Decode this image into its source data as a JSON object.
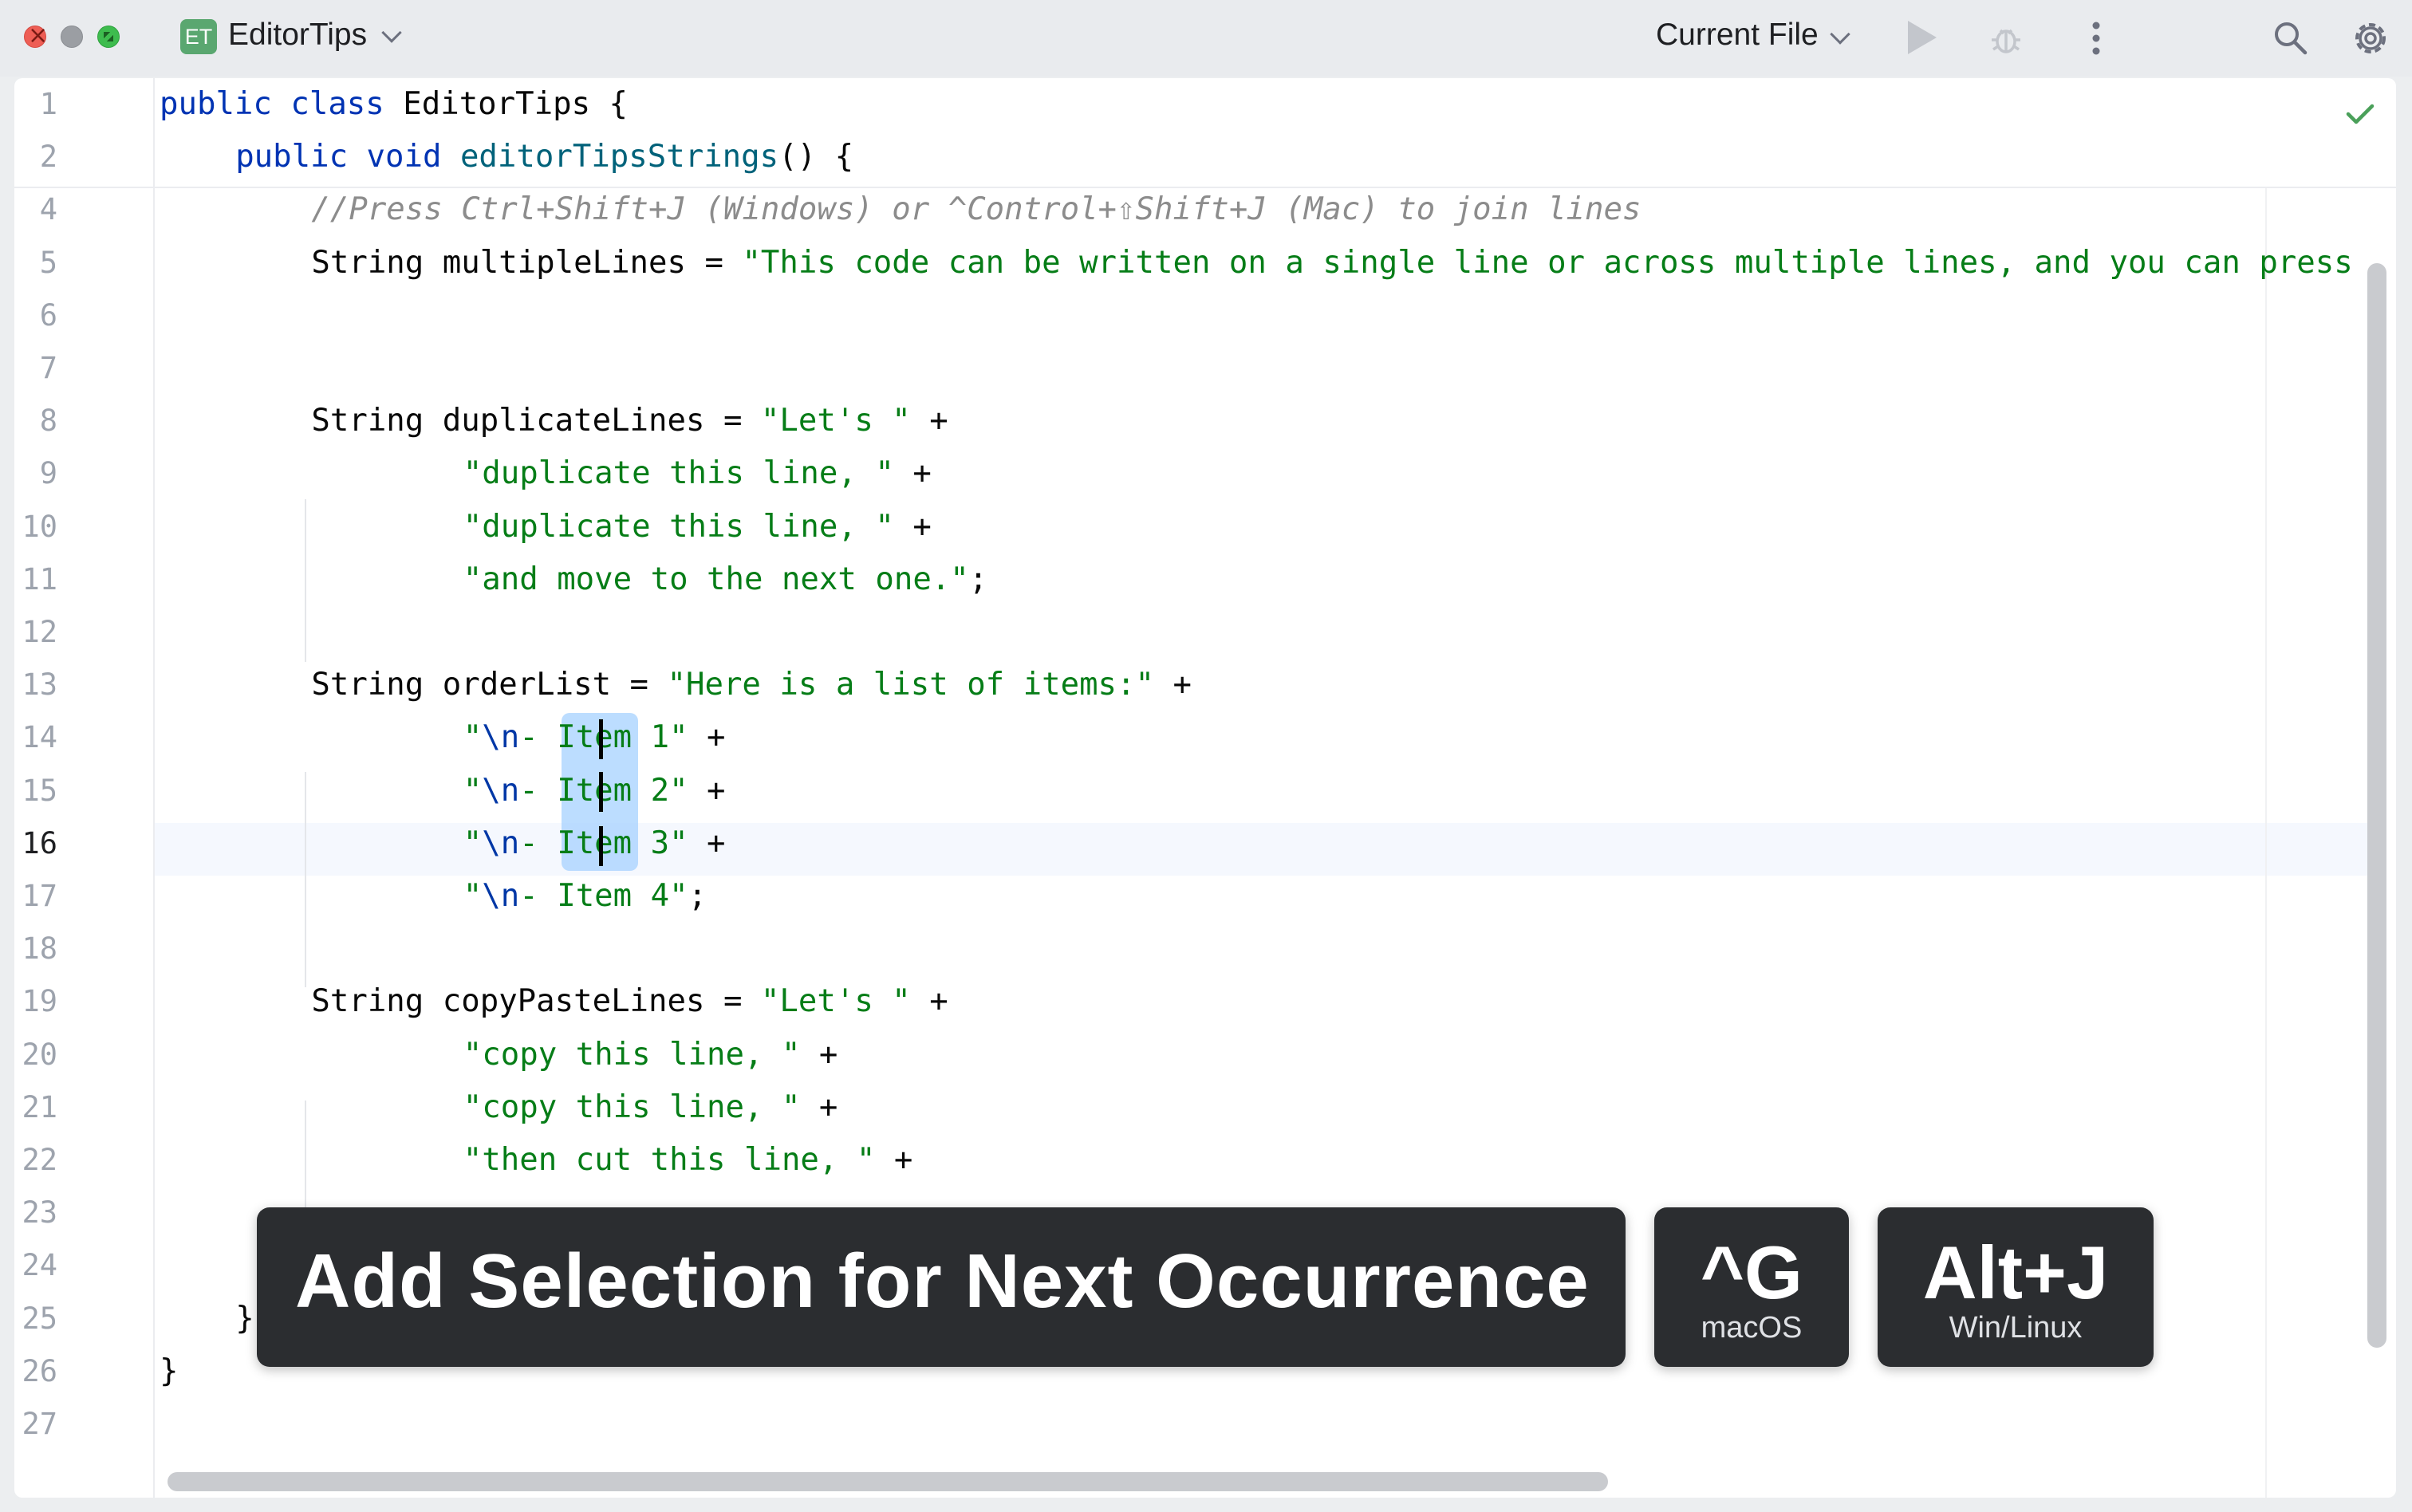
{
  "window": {
    "project_badge": "ET",
    "project_name": "EditorTips",
    "run_config": "Current File"
  },
  "icons": {
    "close": "close-button",
    "minimize": "minimize-button",
    "maximize": "fullscreen-button",
    "project_dropdown": "chevron-down-icon",
    "run_config_dropdown": "chevron-down-icon",
    "run": "play-icon",
    "debug": "bug-icon",
    "more": "more-vertical-icon",
    "search": "search-icon",
    "settings": "gear-icon",
    "inspection_ok": "checkmark-icon"
  },
  "colors": {
    "keyword": "#0033b3",
    "string": "#067d17",
    "comment": "#8c8c8c",
    "method": "#00627a",
    "selection": "#a6d2ff",
    "overlay_bg": "#2b2d30"
  },
  "editor": {
    "lines": [
      {
        "n": "1",
        "indent": 0,
        "parts": [
          [
            "kw",
            "public class "
          ],
          [
            "",
            "EditorTips {"
          ]
        ]
      },
      {
        "n": "2",
        "indent": 4,
        "parts": [
          [
            "kw",
            "public void "
          ],
          [
            "fn",
            "editorTipsStrings"
          ],
          [
            "",
            "() {"
          ]
        ]
      },
      {
        "n": "4",
        "indent": 8,
        "parts": [
          [
            "cmt",
            "//Press Ctrl+Shift+J (Windows) or ^Control+⇧Shift+J (Mac) to join lines"
          ]
        ]
      },
      {
        "n": "5",
        "indent": 8,
        "parts": [
          [
            "",
            "String multipleLines = "
          ],
          [
            "str",
            "\"This code can be written on a single line or across multiple lines, and you can press"
          ]
        ]
      },
      {
        "n": "6",
        "indent": 0,
        "parts": []
      },
      {
        "n": "7",
        "indent": 0,
        "parts": []
      },
      {
        "n": "8",
        "indent": 8,
        "parts": [
          [
            "",
            "String duplicateLines = "
          ],
          [
            "str",
            "\"Let's \""
          ],
          [
            "",
            " +"
          ]
        ]
      },
      {
        "n": "9",
        "indent": 16,
        "parts": [
          [
            "str",
            "\"duplicate this line, \""
          ],
          [
            "",
            " +"
          ]
        ]
      },
      {
        "n": "10",
        "indent": 16,
        "parts": [
          [
            "str",
            "\"duplicate this line, \""
          ],
          [
            "",
            " +"
          ]
        ]
      },
      {
        "n": "11",
        "indent": 16,
        "parts": [
          [
            "str",
            "\"and move to the next one.\""
          ],
          [
            "",
            ";"
          ]
        ]
      },
      {
        "n": "12",
        "indent": 0,
        "parts": []
      },
      {
        "n": "13",
        "indent": 8,
        "parts": [
          [
            "",
            "String orderList = "
          ],
          [
            "str",
            "\"Here is a list of items:\""
          ],
          [
            "",
            " +"
          ]
        ]
      },
      {
        "n": "14",
        "indent": 16,
        "parts": [
          [
            "str",
            "\""
          ],
          [
            "esc",
            "\\n"
          ],
          [
            "str",
            "- Item 1\""
          ],
          [
            "",
            " +"
          ]
        ]
      },
      {
        "n": "15",
        "indent": 16,
        "parts": [
          [
            "str",
            "\""
          ],
          [
            "esc",
            "\\n"
          ],
          [
            "str",
            "- Item 2\""
          ],
          [
            "",
            " +"
          ]
        ]
      },
      {
        "n": "16",
        "indent": 16,
        "parts": [
          [
            "str",
            "\""
          ],
          [
            "esc",
            "\\n"
          ],
          [
            "str",
            "- Item 3\""
          ],
          [
            "",
            " +"
          ]
        ]
      },
      {
        "n": "17",
        "indent": 16,
        "parts": [
          [
            "str",
            "\""
          ],
          [
            "esc",
            "\\n"
          ],
          [
            "str",
            "- Item 4\""
          ],
          [
            "",
            ";"
          ]
        ]
      },
      {
        "n": "18",
        "indent": 0,
        "parts": []
      },
      {
        "n": "19",
        "indent": 8,
        "parts": [
          [
            "",
            "String copyPasteLines = "
          ],
          [
            "str",
            "\"Let's \""
          ],
          [
            "",
            " +"
          ]
        ]
      },
      {
        "n": "20",
        "indent": 16,
        "parts": [
          [
            "str",
            "\"copy this line, \""
          ],
          [
            "",
            " +"
          ]
        ]
      },
      {
        "n": "21",
        "indent": 16,
        "parts": [
          [
            "str",
            "\"copy this line, \""
          ],
          [
            "",
            " +"
          ]
        ]
      },
      {
        "n": "22",
        "indent": 16,
        "parts": [
          [
            "str",
            "\"then cut this line, \""
          ],
          [
            "",
            " +"
          ]
        ]
      },
      {
        "n": "23",
        "indent": 0,
        "parts": []
      },
      {
        "n": "24",
        "indent": 0,
        "parts": []
      },
      {
        "n": "25",
        "indent": 4,
        "parts": [
          [
            "",
            "}"
          ]
        ]
      },
      {
        "n": "26",
        "indent": 0,
        "parts": [
          [
            "",
            "}"
          ]
        ]
      },
      {
        "n": "27",
        "indent": 0,
        "parts": []
      }
    ],
    "current_line": "16"
  },
  "overlay": {
    "action": "Add Selection for Next Occurrence",
    "mac_key": "^G",
    "mac_label": "macOS",
    "win_key": "Alt+J",
    "win_label": "Win/Linux"
  }
}
